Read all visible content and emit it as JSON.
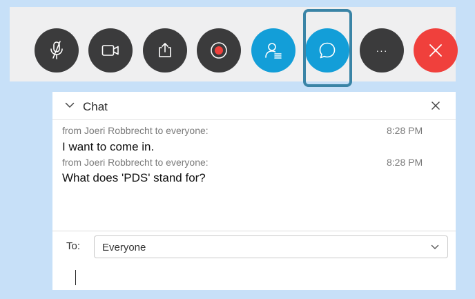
{
  "toolbar": {
    "buttons": [
      {
        "name": "mute-button",
        "icon": "mic-muted-icon",
        "color": "#3b3b3c"
      },
      {
        "name": "video-button",
        "icon": "video-camera-icon",
        "color": "#3b3b3c"
      },
      {
        "name": "share-button",
        "icon": "share-icon",
        "color": "#3b3b3c"
      },
      {
        "name": "record-button",
        "icon": "record-icon",
        "color": "#3b3b3c"
      },
      {
        "name": "participants-button",
        "icon": "participants-icon",
        "color": "#139ed8"
      },
      {
        "name": "chat-button",
        "icon": "chat-bubble-icon",
        "color": "#139ed8"
      },
      {
        "name": "more-options-button",
        "icon": "ellipsis-icon",
        "color": "#3b3b3c",
        "label": "···"
      },
      {
        "name": "end-call-button",
        "icon": "close-icon",
        "color": "#f0403c"
      }
    ],
    "highlight_color": "#3a84a6"
  },
  "chat": {
    "title": "Chat",
    "messages": [
      {
        "meta": "from Joeri Robbrecht to everyone:",
        "time": "8:28 PM",
        "text": "I want to come in."
      },
      {
        "meta": "from Joeri Robbrecht to everyone:",
        "time": "8:28 PM",
        "text": "What does 'PDS' stand for?"
      }
    ],
    "to_label": "To:",
    "to_value": "Everyone"
  }
}
